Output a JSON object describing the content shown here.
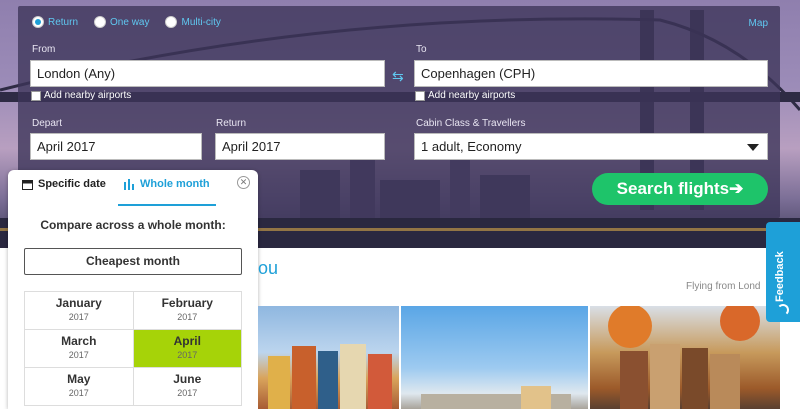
{
  "trip_types": [
    {
      "label": "Return",
      "selected": true
    },
    {
      "label": "One way",
      "selected": false
    },
    {
      "label": "Multi-city",
      "selected": false
    }
  ],
  "map_link": "Map",
  "from": {
    "label": "From",
    "value": "London (Any)",
    "nearby": "Add nearby airports"
  },
  "to": {
    "label": "To",
    "value": "Copenhagen (CPH)",
    "nearby": "Add nearby airports"
  },
  "depart": {
    "label": "Depart",
    "value": "April 2017"
  },
  "return": {
    "label": "Return",
    "value": "April 2017"
  },
  "cabin": {
    "label": "Cabin Class & Travellers",
    "value": "1 adult, Economy"
  },
  "search_button": "Search flights",
  "search_arrow": "➔",
  "picker": {
    "tab_specific": "Specific date",
    "tab_whole": "Whole month",
    "close_glyph": "✕",
    "compare_text": "Compare across a whole month:",
    "cheapest_label": "Cheapest month",
    "months": [
      {
        "month": "January",
        "year": "2017"
      },
      {
        "month": "February",
        "year": "2017"
      },
      {
        "month": "March",
        "year": "2017"
      },
      {
        "month": "April",
        "year": "2017",
        "selected": true
      },
      {
        "month": "May",
        "year": "2017"
      },
      {
        "month": "June",
        "year": "2017"
      }
    ]
  },
  "page": {
    "heading_partial": "ou",
    "flying_from": "Flying from Lond"
  },
  "feedback": "Feedback",
  "colors": {
    "accent": "#1ea0d8",
    "search_green": "#1ec46a",
    "selected_month": "#a6d308"
  }
}
